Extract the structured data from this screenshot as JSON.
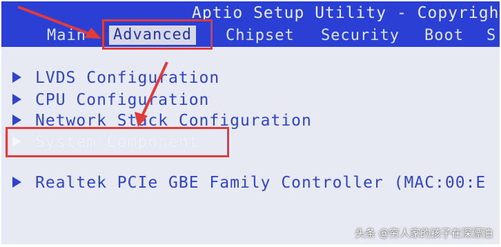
{
  "header": {
    "title": "Aptio Setup Utility - Copyrigh",
    "tabs": [
      {
        "label": "Main"
      },
      {
        "label": "Advanced"
      },
      {
        "label": "Chipset"
      },
      {
        "label": "Security"
      },
      {
        "label": "Boot"
      },
      {
        "label": "S"
      }
    ],
    "active_tab": "Advanced"
  },
  "menu": {
    "items": [
      {
        "label": "LVDS Configuration"
      },
      {
        "label": "CPU Configuration"
      },
      {
        "label": "Network Stack Configuration"
      },
      {
        "label": "System Component"
      },
      {
        "label": "Realtek PCIe GBE Family Controller (MAC:00:E"
      }
    ],
    "selected": "System Component"
  },
  "watermark": "头条 @穷人家的孩子在深漂泊",
  "colors": {
    "header_bg": "#2a3fd4",
    "content_bg": "#e7eaf3",
    "item_text": "#2f44c8",
    "highlight_box": "#e23b3b"
  }
}
